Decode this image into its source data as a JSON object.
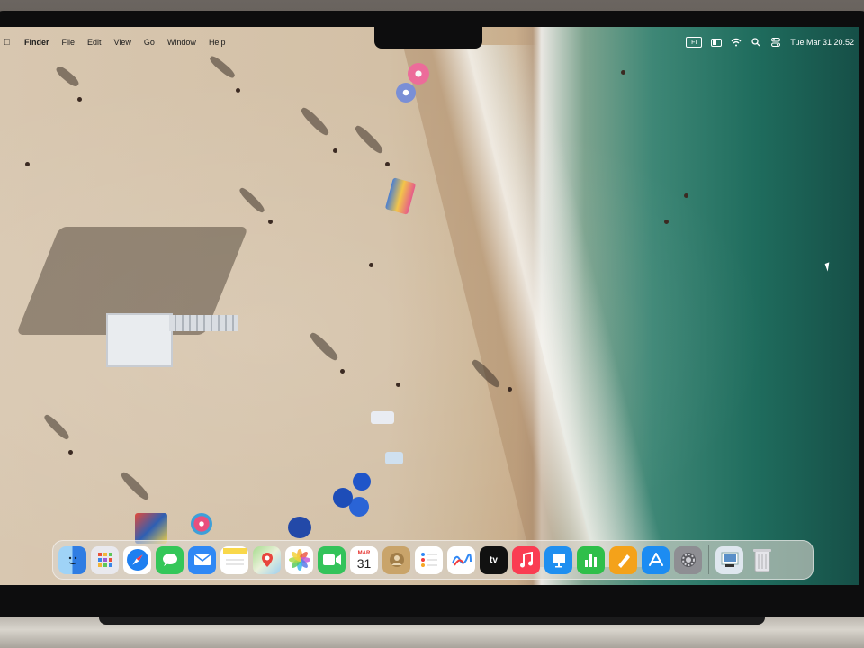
{
  "menubar": {
    "app_name": "Finder",
    "menus": [
      "File",
      "Edit",
      "View",
      "Go",
      "Window",
      "Help"
    ],
    "input_source": "FI",
    "clock": "Tue Mar 31  20.52"
  },
  "dock": {
    "apps": [
      {
        "name": "Finder",
        "icon": "finder-icon",
        "color": "#3b8fe6"
      },
      {
        "name": "Launchpad",
        "icon": "launchpad-icon",
        "color": "#e9e9ee"
      },
      {
        "name": "Safari",
        "icon": "safari-icon",
        "color": "#1e7ff0"
      },
      {
        "name": "Messages",
        "icon": "messages-icon",
        "color": "#34c759"
      },
      {
        "name": "Mail",
        "icon": "mail-icon",
        "color": "#2f88f5"
      },
      {
        "name": "Notes",
        "icon": "notes-icon",
        "color": "#f9d84a"
      },
      {
        "name": "Maps",
        "icon": "maps-icon",
        "color": "#79c46b"
      },
      {
        "name": "Photos",
        "icon": "photos-icon",
        "color": "#ffffff"
      },
      {
        "name": "FaceTime",
        "icon": "facetime-icon",
        "color": "#33c35a"
      },
      {
        "name": "Calendar",
        "icon": "calendar-icon",
        "month": "MAR",
        "day": "31"
      },
      {
        "name": "Contacts",
        "icon": "contacts-icon",
        "color": "#c9a46a"
      },
      {
        "name": "Reminders",
        "icon": "reminders-icon",
        "color": "#ffffff"
      },
      {
        "name": "Freeform",
        "icon": "freeform-icon",
        "color": "#ffffff"
      },
      {
        "name": "TV",
        "icon": "apple-tv-icon",
        "label": "tv"
      },
      {
        "name": "Music",
        "icon": "music-icon",
        "color": "#fa3c52"
      },
      {
        "name": "Keynote",
        "icon": "keynote-icon",
        "color": "#1f8ff0"
      },
      {
        "name": "Numbers",
        "icon": "numbers-icon",
        "color": "#2fbf4a"
      },
      {
        "name": "Pages",
        "icon": "pages-icon",
        "color": "#f4a21a"
      },
      {
        "name": "App Store",
        "icon": "app-store-icon",
        "color": "#1c8cf2"
      },
      {
        "name": "System Settings",
        "icon": "gear-icon",
        "color": "#8e8e93"
      },
      {
        "name": "Preview",
        "icon": "preview-icon",
        "color": "#dfe7ef"
      },
      {
        "name": "Trash",
        "icon": "trash-icon",
        "color": "#e5e5ea"
      }
    ]
  }
}
